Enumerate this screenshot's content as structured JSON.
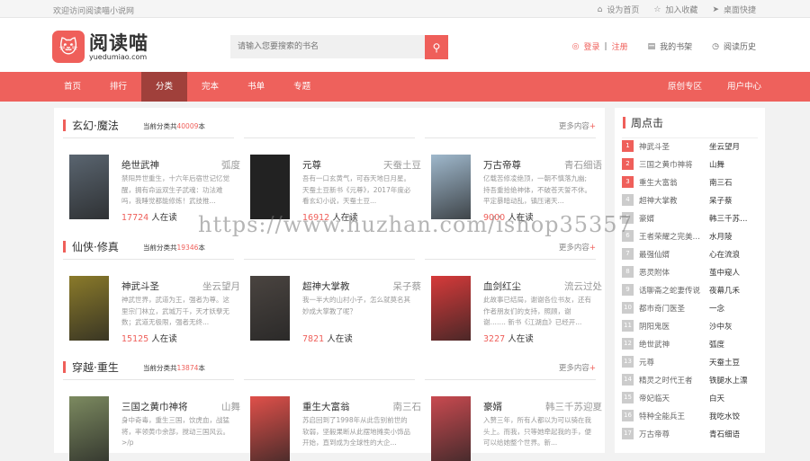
{
  "topbar": {
    "welcome": "欢迎访问阅读喵小说网",
    "links": [
      "设为首页",
      "加入收藏",
      "桌面快捷"
    ]
  },
  "header": {
    "logo_cn": "阅读喵",
    "logo_en": "yuedumiao.com",
    "search_placeholder": "请输入您要搜索的书名",
    "login": "登录",
    "sep": "|",
    "register": "注册",
    "bookshelf": "我的书架",
    "history": "阅读历史"
  },
  "nav": {
    "items": [
      "首页",
      "排行",
      "分类",
      "完本",
      "书单",
      "专题"
    ],
    "active": "分类",
    "right": [
      "原创专区",
      "用户中心"
    ]
  },
  "sections": [
    {
      "title": "玄幻·魔法",
      "count_prefix": "当前分类共",
      "count": "40009",
      "count_suffix": "本",
      "more": "更多内容",
      "plus": "+",
      "books": [
        {
          "title": "绝世武神",
          "author": "弧度",
          "desc": "禁阳异世重生，十六年后宿世记忆觉醒，拥有命运双生子武魂：功法难吗，我睡觉都能修炼！武技推...",
          "readers": "17724",
          "readers_label": "人在读",
          "cover_color": "#5a6570"
        },
        {
          "title": "元尊",
          "author": "天蚕土豆",
          "desc": "吾有一口玄黄气，可吞天地日月星。天蚕土豆新书《元尊》，2017年度必看玄幻小说，天蚕土豆...",
          "readers": "16912",
          "readers_label": "人在读",
          "cover_color": "#222222"
        },
        {
          "title": "万古帝尊",
          "author": "青石细语",
          "desc": "亿载苦修凌绝顶，一朝不慎落九幽;持吾重拾绝神体，不破苍天誓不休。平定暴暗动乱，镇压诸天...",
          "readers": "9000",
          "readers_label": "人在读",
          "cover_color": "#9fb8cc"
        }
      ]
    },
    {
      "title": "仙侠·修真",
      "count_prefix": "当前分类共",
      "count": "19346",
      "count_suffix": "本",
      "more": "更多内容",
      "plus": "+",
      "books": [
        {
          "title": "神武斗圣",
          "author": "坐云望月",
          "desc": "神武世界，武道为王，强者为尊。这里宗门林立，武城万千，天才妖孽无数；武道无极限，强者无终...",
          "readers": "15125",
          "readers_label": "人在读",
          "cover_color": "#8a7a2a"
        },
        {
          "title": "超神大掌教",
          "author": "呆子蔡",
          "desc": "我一半大的山村小子，怎么就莫名其妙成大掌教了呢？",
          "readers": "7821",
          "readers_label": "人在读",
          "cover_color": "#4a4440"
        },
        {
          "title": "血剑红尘",
          "author": "流云过处",
          "desc": "此故事已结局，谢谢各位书友，还有作者朋友们的支持，照顾，谢谢……. 新书《江湖血》已经开...",
          "readers": "3227",
          "readers_label": "人在读",
          "cover_color": "#d63a3a"
        }
      ]
    },
    {
      "title": "穿越·重生",
      "count_prefix": "当前分类共",
      "count": "13874",
      "count_suffix": "本",
      "more": "更多内容",
      "plus": "+",
      "books": [
        {
          "title": "三国之黄巾神将",
          "author": "山舞",
          "desc": "身中奇毒，重生三国，饮虎血，战猛将，率领黄巾余部，搅动三国风云。>/p",
          "readers": "",
          "readers_label": "",
          "cover_color": "#7c8a60"
        },
        {
          "title": "重生大富翁",
          "author": "南三石",
          "desc": "苏启回到了1998年从此告别前世的软弱，坚毅果断从此摆地摊卖小饰品开始，直到成为全球性的大企...",
          "readers": "",
          "readers_label": "",
          "cover_color": "#e0504a"
        },
        {
          "title": "豪婿",
          "author": "韩三千苏迎夏",
          "desc": "入赘三年，所有人都以为可以骑在我头上。而我，只等她牵起我的手，便可以给她整个世界。新...",
          "readers": "",
          "readers_label": "",
          "cover_color": "#c94a50"
        }
      ]
    }
  ],
  "sidebar": {
    "title": "周点击",
    "items": [
      {
        "n": "1",
        "name": "神武斗圣",
        "author": "坐云望月"
      },
      {
        "n": "2",
        "name": "三国之黄巾神将",
        "author": "山舞"
      },
      {
        "n": "3",
        "name": "重生大富翁",
        "author": "南三石"
      },
      {
        "n": "4",
        "name": "超神大掌教",
        "author": "呆子蔡"
      },
      {
        "n": "5",
        "name": "豪婿",
        "author": "韩三千苏迎夏"
      },
      {
        "n": "6",
        "name": "王者荣耀之完美人生",
        "author": "水月陵"
      },
      {
        "n": "7",
        "name": "最强仙婿",
        "author": "心在流浪"
      },
      {
        "n": "8",
        "name": "恶灵附体",
        "author": "茧中窥人"
      },
      {
        "n": "9",
        "name": "话聊斋之蛇妻传说",
        "author": "夜幕几禾"
      },
      {
        "n": "10",
        "name": "都市奇门医圣",
        "author": "一念"
      },
      {
        "n": "11",
        "name": "阴阳鬼医",
        "author": "沙中灰"
      },
      {
        "n": "12",
        "name": "绝世武神",
        "author": "弧度"
      },
      {
        "n": "13",
        "name": "元尊",
        "author": "天蚕土豆"
      },
      {
        "n": "14",
        "name": "精灵之时代王者",
        "author": "铁腿水上漂"
      },
      {
        "n": "15",
        "name": "帝妃临天",
        "author": "白天"
      },
      {
        "n": "16",
        "name": "特种全能兵王",
        "author": "我吃水饺"
      },
      {
        "n": "17",
        "name": "万古帝尊",
        "author": "青石细语"
      }
    ]
  },
  "watermark": "https://www.huzhan.com/ishop35357",
  "colors": {
    "accent": "#ee615c",
    "nav_active": "#a0403b"
  }
}
